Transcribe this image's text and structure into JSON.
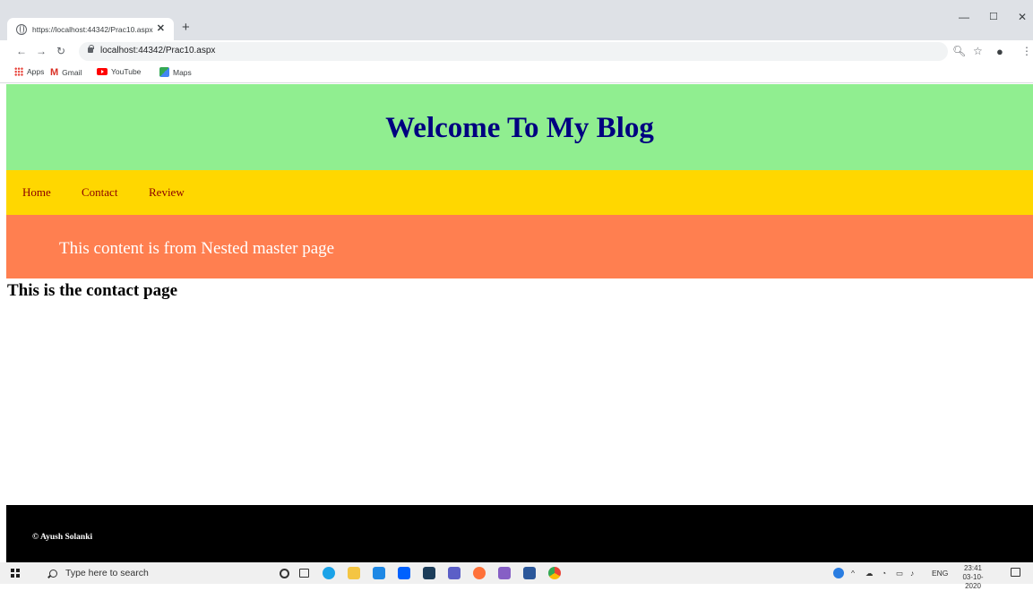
{
  "browser": {
    "tab_title": "https://localhost:44342/Prac10.aspx",
    "url": "localhost:44342/Prac10.aspx",
    "bookmarks": [
      "Apps",
      "Gmail",
      "YouTube",
      "Maps"
    ]
  },
  "site": {
    "header_title": "Welcome To My Blog",
    "menu": [
      "Home",
      "Contact",
      "Review"
    ],
    "nested_text": "This content is from Nested master page",
    "page_heading": "This is the contact page",
    "footer_text": "© Ayush Solanki"
  },
  "taskbar": {
    "search_placeholder": "Type here to search",
    "language": "ENG",
    "time": "23:41",
    "date": "03-10-2020"
  },
  "colors": {
    "header_bg": "#90ee90",
    "header_text": "#000080",
    "menu_bg": "#ffd700",
    "menu_link": "#8b0000",
    "nested_bg": "#ff7f50",
    "footer_bg": "#000000"
  }
}
